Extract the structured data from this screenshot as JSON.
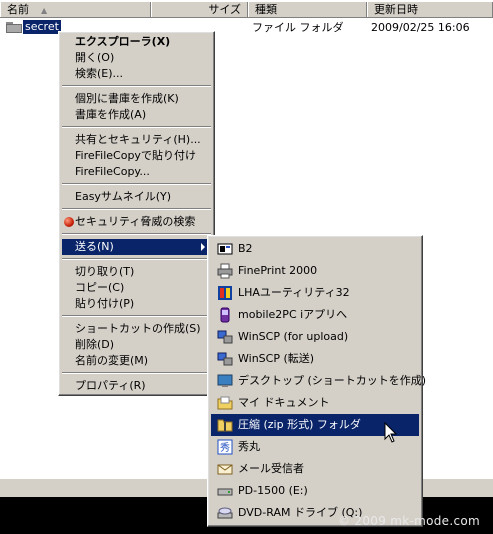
{
  "columns": {
    "name": "名前",
    "size": "サイズ",
    "type": "種類",
    "modified": "更新日時"
  },
  "file": {
    "name": "secret",
    "type": "ファイル フォルダ",
    "modified": "2009/02/25 16:06"
  },
  "context_menu": {
    "items": [
      "エクスプローラ(X)",
      "開く(O)",
      "検索(E)...",
      "個別に書庫を作成(K)",
      "書庫を作成(A)",
      "共有とセキュリティ(H)...",
      "FireFileCopyで貼り付け",
      "FireFileCopy...",
      "Easyサムネイル(Y)",
      "セキュリティ脅威の検索",
      "送る(N)",
      "切り取り(T)",
      "コピー(C)",
      "貼り付け(P)",
      "ショートカットの作成(S)",
      "削除(D)",
      "名前の変更(M)",
      "プロパティ(R)"
    ]
  },
  "send_to_menu": {
    "items": [
      "B2",
      "FinePrint 2000",
      "LHAユーティリティ32",
      "mobile2PC iアプリへ",
      "WinSCP (for upload)",
      "WinSCP (転送)",
      "デスクトップ (ショートカットを作成)",
      "マイ ドキュメント",
      "圧縮 (zip 形式) フォルダ",
      "秀丸",
      "メール受信者",
      "PD-1500 (E:)",
      "DVD-RAM ドライブ (Q:)"
    ],
    "icons": [
      "b2-icon",
      "printer-icon",
      "lha-icon",
      "mobile-icon",
      "winscp-icon",
      "winscp-icon",
      "desktop-icon",
      "my-documents-icon",
      "zip-folder-icon",
      "hidemaru-icon",
      "mail-icon",
      "drive-icon",
      "dvd-drive-icon"
    ]
  },
  "watermark": "© 2009 mk-mode.com",
  "colors": {
    "selection": "#0a246a",
    "menu_bg": "#d4d0c8"
  }
}
